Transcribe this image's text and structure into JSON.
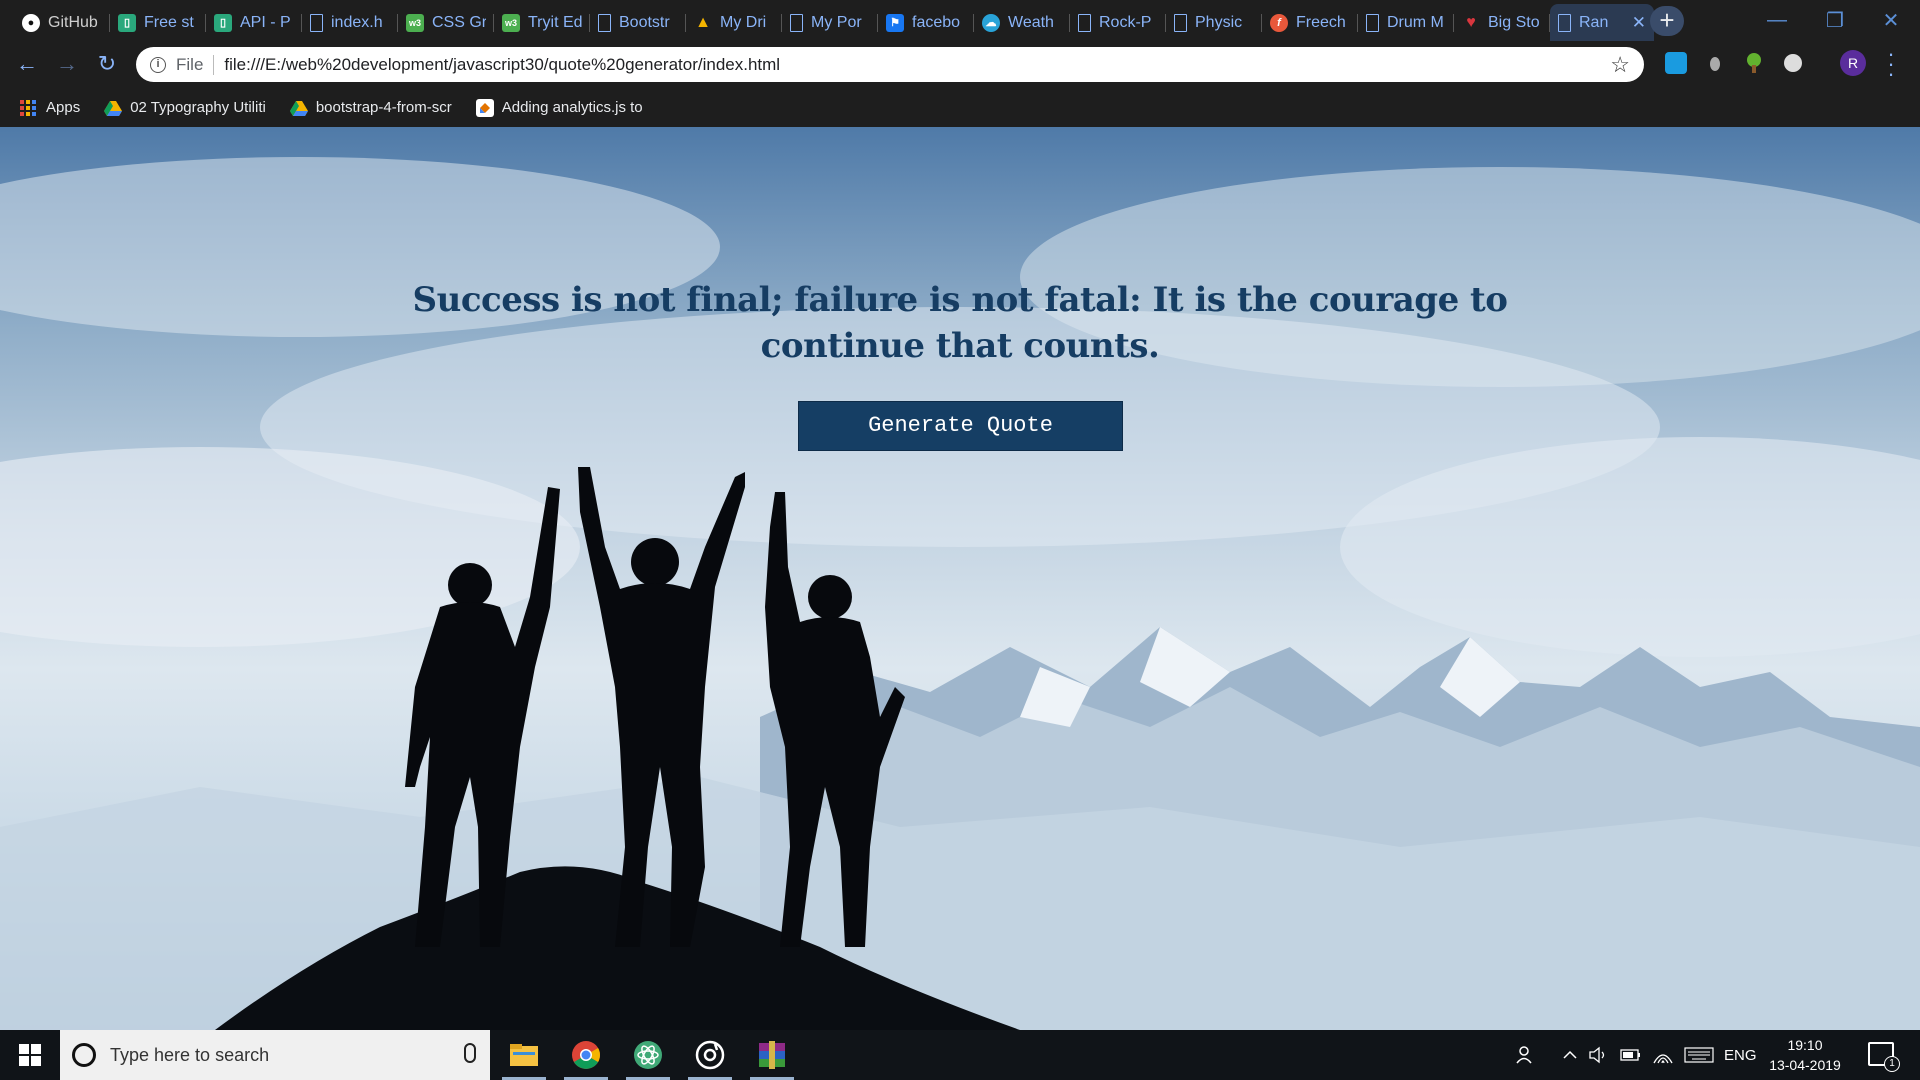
{
  "tabs": [
    {
      "title": "GitHub",
      "icon": "github-icon",
      "color": "#24292e"
    },
    {
      "title": "Free st",
      "icon": "tryit-icon",
      "color": "#2aa87c"
    },
    {
      "title": "API - P",
      "icon": "tryit-icon",
      "color": "#2aa87c"
    },
    {
      "title": "index.h",
      "icon": "document-icon",
      "color": ""
    },
    {
      "title": "CSS Gr",
      "icon": "w3-icon",
      "color": "#4caf50"
    },
    {
      "title": "Tryit Ed",
      "icon": "w3-icon",
      "color": "#4caf50"
    },
    {
      "title": "Bootstr",
      "icon": "document-icon",
      "color": ""
    },
    {
      "title": "My Dri",
      "icon": "drive-icon",
      "color": "#f4b400"
    },
    {
      "title": "My Por",
      "icon": "document-icon",
      "color": ""
    },
    {
      "title": "facebo",
      "icon": "flag-icon",
      "color": "#1877f2"
    },
    {
      "title": "Weath",
      "icon": "cloud-icon",
      "color": "#29a3d8"
    },
    {
      "title": "Rock-P",
      "icon": "document-icon",
      "color": ""
    },
    {
      "title": "Physic",
      "icon": "document-icon",
      "color": ""
    },
    {
      "title": "Freech",
      "icon": "freecodecamp-icon",
      "color": "#e8583b"
    },
    {
      "title": "Drum M",
      "icon": "document-icon",
      "color": ""
    },
    {
      "title": "Big Sto",
      "icon": "heart-icon",
      "color": "#d9363e"
    },
    {
      "title": "Ran",
      "icon": "document-icon",
      "color": "",
      "active": true
    }
  ],
  "address_bar": {
    "scheme_label": "File",
    "url": "file:///E:/web%20development/javascript30/quote%20generator/index.html"
  },
  "bookmarks": [
    {
      "label": "Apps",
      "icon": "apps-grid-icon"
    },
    {
      "label": "02 Typography Utiliti",
      "icon": "drive-icon"
    },
    {
      "label": "bootstrap-4-from-scr",
      "icon": "drive-icon"
    },
    {
      "label": "Adding analytics.js to",
      "icon": "analytics-icon"
    }
  ],
  "profile_initial": "R",
  "page": {
    "quote": "Success is not final; failure is not fatal: It is the courage to continue that counts.",
    "button_label": "Generate Quote",
    "colors": {
      "quote_text": "#163d63",
      "button_bg": "#153e64",
      "button_text": "#ffffff"
    }
  },
  "taskbar": {
    "search_placeholder": "Type here to search",
    "apps": [
      "file-explorer-icon",
      "chrome-icon",
      "atom-icon",
      "groove-music-icon",
      "winrar-icon"
    ],
    "language": "ENG",
    "time": "19:10",
    "date": "13-04-2019",
    "notification_count": "1"
  }
}
